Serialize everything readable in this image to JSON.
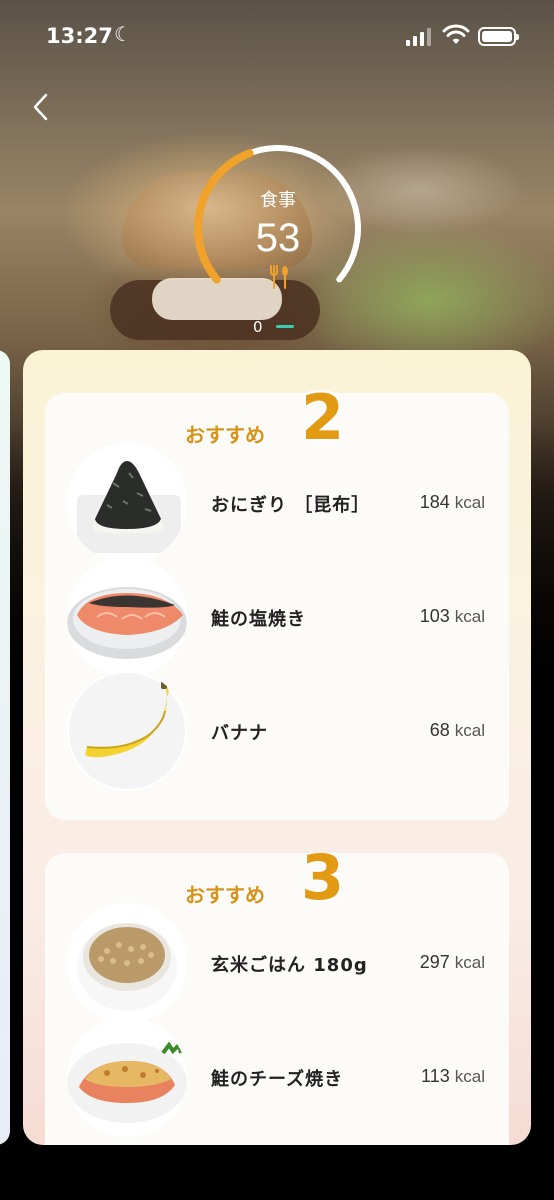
{
  "status_bar": {
    "time": "13:27"
  },
  "gauge": {
    "label": "食事",
    "value": "53",
    "min_label": "0",
    "progress": 0.42,
    "accent": "#f0a22a"
  },
  "recommendations": [
    {
      "title": "おすすめ",
      "number": "2",
      "items": [
        {
          "name": "おにぎり ［昆布］",
          "kcal": "184",
          "unit": "kcal",
          "image": "onigiri"
        },
        {
          "name": "鮭の塩焼き",
          "kcal": "103",
          "unit": "kcal",
          "image": "grilled-salmon"
        },
        {
          "name": "バナナ",
          "kcal": "68",
          "unit": "kcal",
          "image": "banana"
        }
      ]
    },
    {
      "title": "おすすめ",
      "number": "3",
      "items": [
        {
          "name": "玄米ごはん 180g",
          "kcal": "297",
          "unit": "kcal",
          "image": "brown-rice"
        },
        {
          "name": "鮭のチーズ焼き",
          "kcal": "113",
          "unit": "kcal",
          "image": "cheese-salmon"
        }
      ]
    }
  ],
  "colors": {
    "heading": "#d5931b",
    "number": "#e29a13",
    "card_top": "#fbf3d6",
    "card_bottom": "#f6dcd3"
  }
}
